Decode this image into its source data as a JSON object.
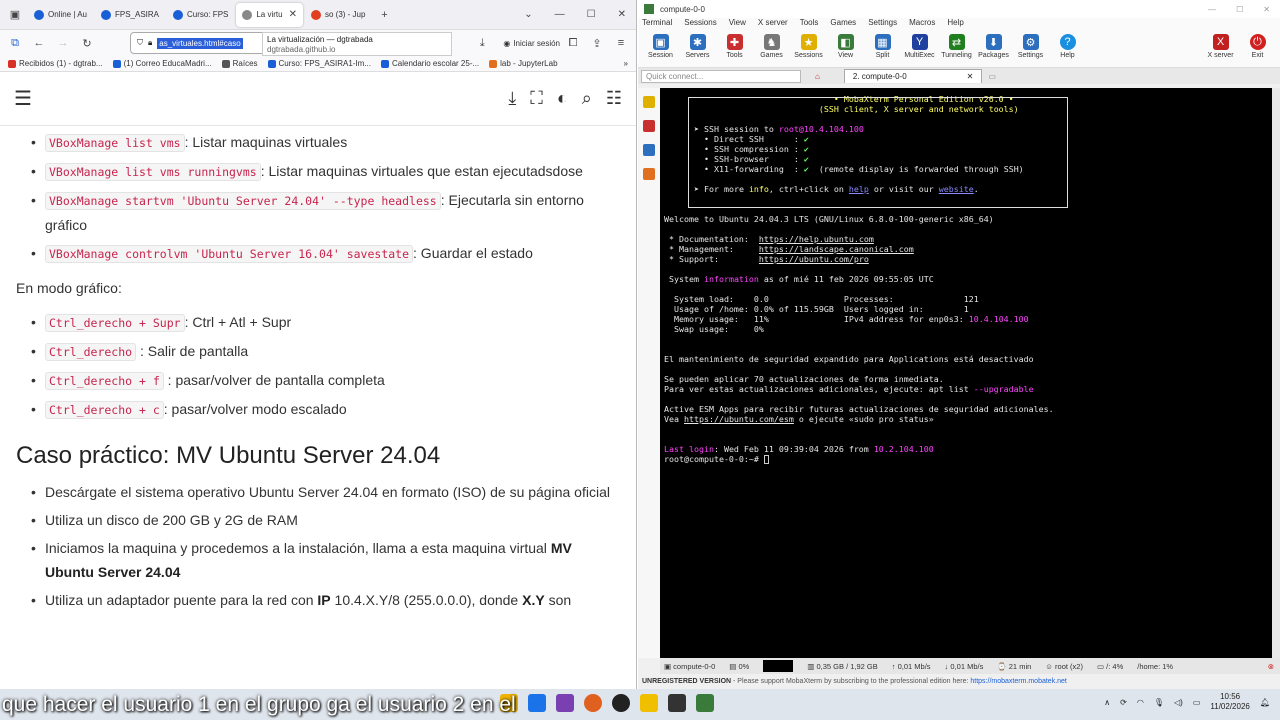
{
  "browser": {
    "tabs": [
      {
        "label": "",
        "icon": "tab-overview-icon"
      },
      {
        "label": "Online | Au",
        "color": "#1a5fd6"
      },
      {
        "label": "FPS_ASIRA",
        "color": "#1a5fd6"
      },
      {
        "label": "Curso: FPS",
        "color": "#1a5fd6"
      },
      {
        "label": "La virtu",
        "color": "#888888",
        "active": true
      },
      {
        "label": "so (3) - Jup",
        "color": "#e04020"
      }
    ],
    "url_selected": "as_virtuales.html#caso",
    "url_popup_title": "La virtualización — dgtrabada",
    "url_popup_sub": "dgtrabada.github.io",
    "signin_label": "Iniciar sesión",
    "bookmarks": [
      {
        "label": "Recibidos (1) - dgtrab...",
        "color": "#d93025"
      },
      {
        "label": "(1) Correo EducaMadri...",
        "color": "#1a5fd6"
      },
      {
        "label": "Raíces",
        "color": "#555555"
      },
      {
        "label": "Curso: FPS_ASIRA1-Im...",
        "color": "#1a5fd6"
      },
      {
        "label": "Calendario escolar 25-...",
        "color": "#1a5fd6"
      },
      {
        "label": "lab - JupyterLab",
        "color": "#e07020"
      }
    ]
  },
  "doc": {
    "list1": [
      {
        "code": "VBoxManage list vms",
        "text": ": Listar maquinas virtuales"
      },
      {
        "code": "VBoxManage list vms runningvms",
        "text": ": Listar maquinas virtuales que estan ejecutadsdose"
      },
      {
        "code": "VBoxManage startvm 'Ubuntu Server 24.04' --type headless",
        "text": ": Ejecutarla sin entorno gráfico"
      },
      {
        "code": "VBoxManage controlvm 'Ubuntu Server 16.04' savestate",
        "text": ": Guardar el estado"
      }
    ],
    "grafico": "En modo gráfico:",
    "list2": [
      {
        "code": "Ctrl_derecho + Supr",
        "text": ": Ctrl + Atl + Supr"
      },
      {
        "code": "Ctrl_derecho",
        "text": " : Salir de pantalla"
      },
      {
        "code": "Ctrl_derecho + f",
        "text": " : pasar/volver de pantalla completa"
      },
      {
        "code": "Ctrl_derecho + c",
        "text": ": pasar/volver modo escalado"
      }
    ],
    "heading": "Caso práctico: MV Ubuntu Server 24.04",
    "bul1": "Descárgate el sistema operativo Ubuntu Server 24.04 en formato (ISO) de su página oficial",
    "bul2": "Utiliza un disco de 200 GB y 2G de RAM",
    "bul3a": "Iniciamos la maquina y procedemos a la instalación, llama a esta maquina virtual ",
    "bul3b": "MV Ubuntu Server 24.04",
    "bul4a": "Utiliza un adaptador puente para la red con ",
    "bul4b": "IP",
    "bul4c": " 10.4.X.Y/8 (255.0.0.0), donde ",
    "bul4d": "X.Y",
    "bul4e": " son"
  },
  "moba": {
    "title": "compute-0-0",
    "menu": [
      "Terminal",
      "Sessions",
      "View",
      "X server",
      "Tools",
      "Games",
      "Settings",
      "Macros",
      "Help"
    ],
    "tools": [
      {
        "label": "Session",
        "icon": "session-icon",
        "color": "#2c6fbf"
      },
      {
        "label": "Servers",
        "icon": "servers-icon",
        "color": "#2c6fbf"
      },
      {
        "label": "Tools",
        "icon": "tools-icon",
        "color": "#c83030"
      },
      {
        "label": "Games",
        "icon": "games-icon",
        "color": "#777777"
      },
      {
        "label": "Sessions",
        "icon": "star-icon",
        "color": "#e0b000"
      },
      {
        "label": "View",
        "icon": "view-icon",
        "color": "#3a7a3a"
      },
      {
        "label": "Split",
        "icon": "split-icon",
        "color": "#2c6fbf"
      },
      {
        "label": "MultiExec",
        "icon": "multiexec-icon",
        "color": "#2040a0"
      },
      {
        "label": "Tunneling",
        "icon": "tunneling-icon",
        "color": "#208020"
      },
      {
        "label": "Packages",
        "icon": "packages-icon",
        "color": "#2c6fbf"
      },
      {
        "label": "Settings",
        "icon": "settings-icon",
        "color": "#2c6fbf"
      },
      {
        "label": "Help",
        "icon": "help-icon",
        "color": "#1a8fe0"
      }
    ],
    "tools_right": [
      {
        "label": "X server",
        "icon": "xserver-icon",
        "color": "#c02020"
      },
      {
        "label": "Exit",
        "icon": "power-icon",
        "color": "#d02020"
      }
    ],
    "quick_connect": "Quick connect...",
    "session_tab": "2. compute-0-0",
    "status": [
      "compute-0-0",
      "0%",
      "0,35 GB / 1,92 GB",
      "0,01 Mb/s",
      "0,01 Mb/s",
      "21 min",
      "root (x2)",
      "/: 4%",
      "/home: 1%"
    ],
    "unregistered": "UNREGISTERED VERSION",
    "unreg_text": "  -  Please support MobaXterm by subscribing to the professional edition here: ",
    "unreg_link": "https://mobaxterm.mobatek.net"
  },
  "terminal": {
    "banner_title": "• MobaXterm Personal Edition v26.0 •",
    "banner_sub": "(SSH client, X server and network tools)",
    "ssh_line_pre": "➤ SSH session to ",
    "ssh_host": "root@10.4.104.100",
    "direct": "  • Direct SSH      : ",
    "compression": "  • SSH compression : ",
    "browser": "  • SSH-browser     : ",
    "x11": "  • X11-forwarding  : ",
    "check": "✔",
    "x11_note": "  (remote display is forwarded through SSH)",
    "more_pre": "➤ For more ",
    "more_info": "info",
    "more_mid": ", ctrl+click on ",
    "more_help": "help",
    "more_mid2": " or visit our ",
    "more_web": "website",
    "more_end": ".",
    "welcome": "Welcome to Ubuntu 24.04.3 LTS (GNU/Linux 6.8.0-100-generic x86_64)",
    "doc_label": " * Documentation:  ",
    "doc_url": "https://help.ubuntu.com",
    "mgmt_label": " * Management:     ",
    "mgmt_url": "https://landscape.canonical.com",
    "sup_label": " * Support:        ",
    "sup_url": "https://ubuntu.com/pro",
    "sysinfo_pre": " System ",
    "sysinfo_word": "information",
    "sysinfo_post": " as of mié 11 feb 2026 09:55:05 UTC",
    "load": "  System load:    0.0               Processes:              121",
    "usage": "  Usage of /home: 0.0% of 115.59GB  Users logged in:        1",
    "mem_pre": "  Memory usage:   11%               IPv4 address for enp0s3: ",
    "mem_ip": "10.4.104.100",
    "swap": "  Swap usage:     0%",
    "esm": "El mantenimiento de seguridad expandido para Applications está desactivado",
    "upd1": "Se pueden aplicar 70 actualizaciones de forma inmediata.",
    "upd2_pre": "Para ver estas actualizaciones adicionales, ejecute: apt list ",
    "upd2_flag": "--upgradable",
    "esm2": "Active ESM Apps para recibir futuras actualizaciones de seguridad adicionales.",
    "esm3_pre": "Vea ",
    "esm3_url": "https://ubuntu.com/esm",
    "esm3_post": " o ejecute «sudo pro status»",
    "last_pre": "Last login",
    "last_mid": ": Wed Feb 11 09:39:04 2026 from ",
    "last_ip": "10.2.104.100",
    "prompt": "root@compute-0-0:~# "
  },
  "taskbar": {
    "subtitle": "que hacer el usuario 1 en el grupo ga el usuario 2 en el",
    "time": "10:56",
    "date": "11/02/2026",
    "apps": [
      {
        "icon": "file-explorer-icon",
        "color": "#f0b400"
      },
      {
        "icon": "vscode-icon",
        "color": "#1a73e8"
      },
      {
        "icon": "visual-studio-icon",
        "color": "#7a3fb0"
      },
      {
        "icon": "firefox-icon",
        "color": "#e06020"
      },
      {
        "icon": "github-icon",
        "color": "#222222"
      },
      {
        "icon": "notepad-icon",
        "color": "#f0c000"
      },
      {
        "icon": "terminal-icon",
        "color": "#333333"
      },
      {
        "icon": "mobaxterm-icon",
        "color": "#3a7a3a"
      }
    ]
  }
}
